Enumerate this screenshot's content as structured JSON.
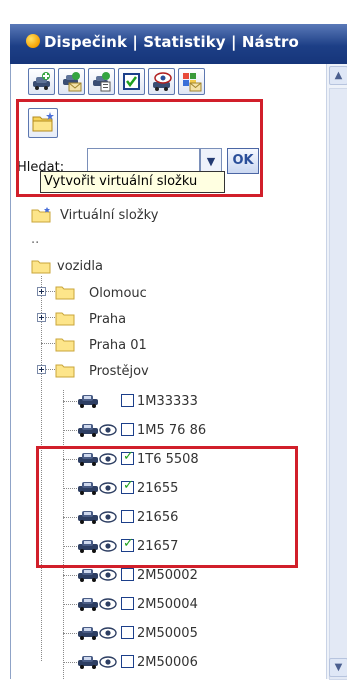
{
  "app": {
    "menu_text": "Dispečink  |  Statistiky  |  Nástro"
  },
  "toolbar": {
    "buttons": [
      {
        "name": "add-vehicle-button",
        "icon": "car-plus-icon"
      },
      {
        "name": "send-vehicle-message-button",
        "icon": "car-envelope-icon"
      },
      {
        "name": "vehicle-document-button",
        "icon": "car-document-icon"
      },
      {
        "name": "checkbox-select-button",
        "icon": "checkbox-icon"
      },
      {
        "name": "vehicle-visibility-button",
        "icon": "car-eye-icon"
      },
      {
        "name": "group-message-button",
        "icon": "group-envelope-icon"
      }
    ],
    "create_virtual_folder_icon": "folder-star-icon"
  },
  "search": {
    "label": "Hledat:",
    "value": "",
    "ok_label": "OK"
  },
  "tooltip": {
    "text": "Vytvořit virtuální složku"
  },
  "tree": {
    "virtual_folders_label": "Virtuální složky",
    "ellipsis": "..",
    "root_label": "vozidla",
    "folders": [
      {
        "label": "Olomouc",
        "expandable": true
      },
      {
        "label": "Praha",
        "expandable": true
      },
      {
        "label": "Praha 01",
        "expandable": false
      },
      {
        "label": "Prostějov",
        "expandable": true
      }
    ],
    "vehicles": [
      {
        "label": "1M33333",
        "checked": false,
        "eye": false
      },
      {
        "label": "1M5 76 86",
        "checked": false,
        "eye": true
      },
      {
        "label": "1T6 5508",
        "checked": true,
        "eye": true
      },
      {
        "label": "21655",
        "checked": true,
        "eye": true
      },
      {
        "label": "21656",
        "checked": false,
        "eye": true
      },
      {
        "label": "21657",
        "checked": true,
        "eye": true
      },
      {
        "label": "2M50002",
        "checked": false,
        "eye": true
      },
      {
        "label": "2M50004",
        "checked": false,
        "eye": true
      },
      {
        "label": "2M50005",
        "checked": false,
        "eye": true
      },
      {
        "label": "2M50006",
        "checked": false,
        "eye": true
      }
    ]
  },
  "colors": {
    "highlight": "#d11f2a",
    "menu_bar": "#1d3f86",
    "check": "#20a020",
    "folder": "#f2c94c"
  }
}
